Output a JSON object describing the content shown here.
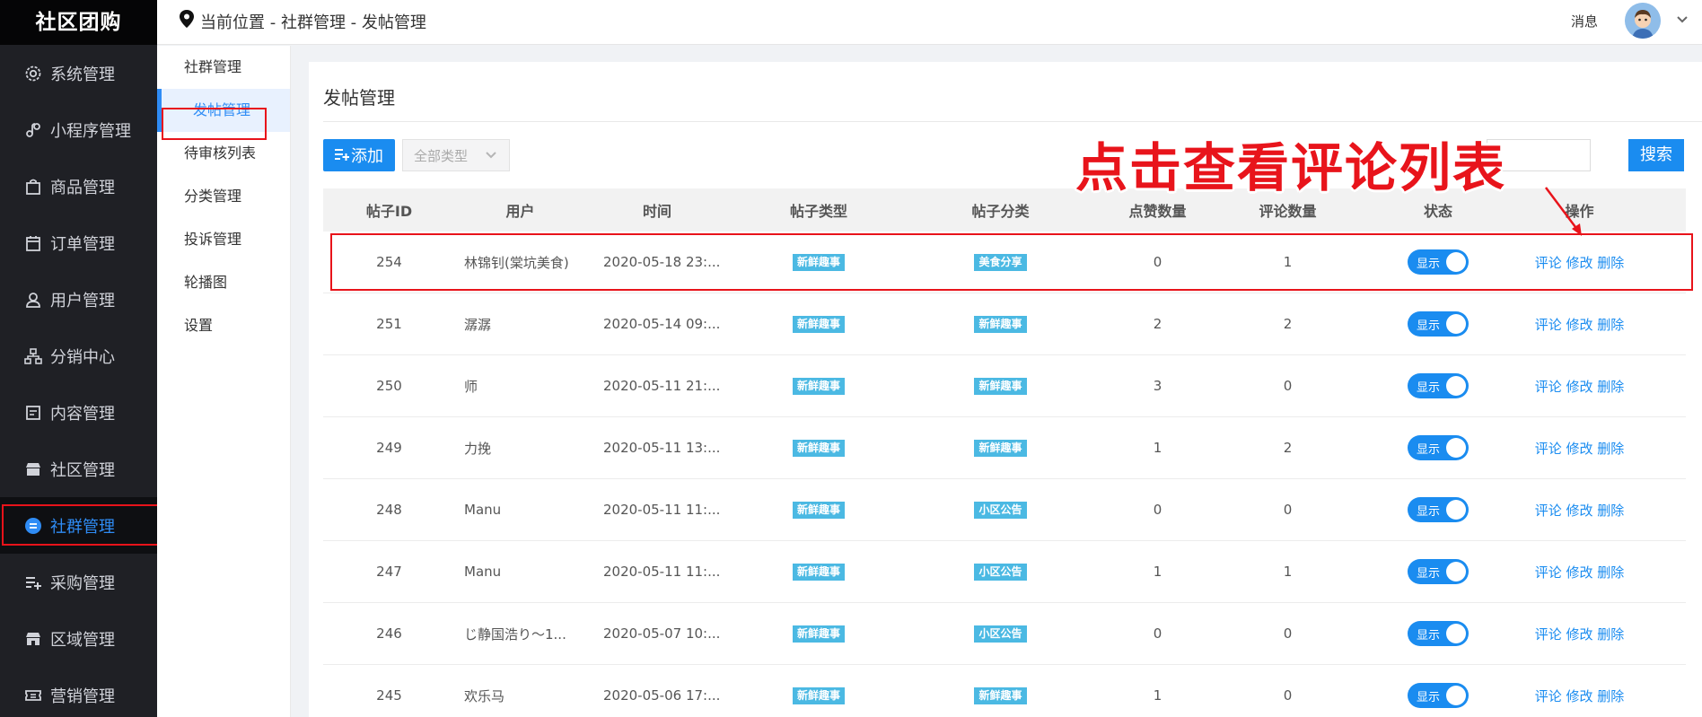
{
  "app": {
    "logo": "社区团购"
  },
  "sidebar": {
    "items": [
      {
        "label": "系统管理",
        "icon": "gear-icon"
      },
      {
        "label": "小程序管理",
        "icon": "mini-program-icon"
      },
      {
        "label": "商品管理",
        "icon": "bag-icon"
      },
      {
        "label": "订单管理",
        "icon": "calendar-icon"
      },
      {
        "label": "用户管理",
        "icon": "user-icon"
      },
      {
        "label": "分销中心",
        "icon": "org-chart-icon"
      },
      {
        "label": "内容管理",
        "icon": "document-icon"
      },
      {
        "label": "社区管理",
        "icon": "store-icon"
      },
      {
        "label": "社群管理",
        "icon": "chat-bubble-icon",
        "active": true
      },
      {
        "label": "采购管理",
        "icon": "playlist-add-icon"
      },
      {
        "label": "区域管理",
        "icon": "shop-icon"
      },
      {
        "label": "营销管理",
        "icon": "ticket-icon"
      }
    ]
  },
  "header": {
    "breadcrumb": "当前位置 - 社群管理 - 发帖管理",
    "messages": "消息"
  },
  "submenu": {
    "items": [
      {
        "label": "社群管理"
      },
      {
        "label": "发帖管理",
        "active": true
      },
      {
        "label": "待审核列表"
      },
      {
        "label": "分类管理"
      },
      {
        "label": "投诉管理"
      },
      {
        "label": "轮播图"
      },
      {
        "label": "设置"
      }
    ]
  },
  "main": {
    "title": "发帖管理",
    "add_label": "添加",
    "type_select": "全部类型",
    "search_label": "搜索",
    "annotation": "点击查看评论列表"
  },
  "table": {
    "headers": [
      "帖子ID",
      "用户",
      "时间",
      "帖子类型",
      "帖子分类",
      "点赞数量",
      "评论数量",
      "状态",
      "操作"
    ],
    "ops": [
      "评论",
      "修改",
      "删除"
    ],
    "status_label": "显示",
    "rows": [
      {
        "id": "254",
        "user": "林锦钊(棠坑美食)",
        "time": "2020-05-18 23:...",
        "type": "新鲜趣事",
        "category": "美食分享",
        "likes": "0",
        "comments": "1"
      },
      {
        "id": "251",
        "user": "潺潺",
        "time": "2020-05-14 09:...",
        "type": "新鲜趣事",
        "category": "新鲜趣事",
        "likes": "2",
        "comments": "2"
      },
      {
        "id": "250",
        "user": "师",
        "time": "2020-05-11 21:...",
        "type": "新鲜趣事",
        "category": "新鲜趣事",
        "likes": "3",
        "comments": "0"
      },
      {
        "id": "249",
        "user": "力挽",
        "time": "2020-05-11 13:...",
        "type": "新鲜趣事",
        "category": "新鲜趣事",
        "likes": "1",
        "comments": "2"
      },
      {
        "id": "248",
        "user": "Manu",
        "time": "2020-05-11 11:...",
        "type": "新鲜趣事",
        "category": "小区公告",
        "likes": "0",
        "comments": "0"
      },
      {
        "id": "247",
        "user": "Manu",
        "time": "2020-05-11 11:...",
        "type": "新鲜趣事",
        "category": "小区公告",
        "likes": "1",
        "comments": "1"
      },
      {
        "id": "246",
        "user": "じ静国浩り～1...",
        "time": "2020-05-07 10:...",
        "type": "新鲜趣事",
        "category": "小区公告",
        "likes": "0",
        "comments": "0"
      },
      {
        "id": "245",
        "user": "欢乐马",
        "time": "2020-05-06 17:...",
        "type": "新鲜趣事",
        "category": "新鲜趣事",
        "likes": "1",
        "comments": "0"
      }
    ]
  },
  "colors": {
    "accent": "#1a8cf0",
    "sidebar_bg": "#1f2025",
    "annotation_red": "#e8141b",
    "tag_bg": "#4bb9e3"
  }
}
